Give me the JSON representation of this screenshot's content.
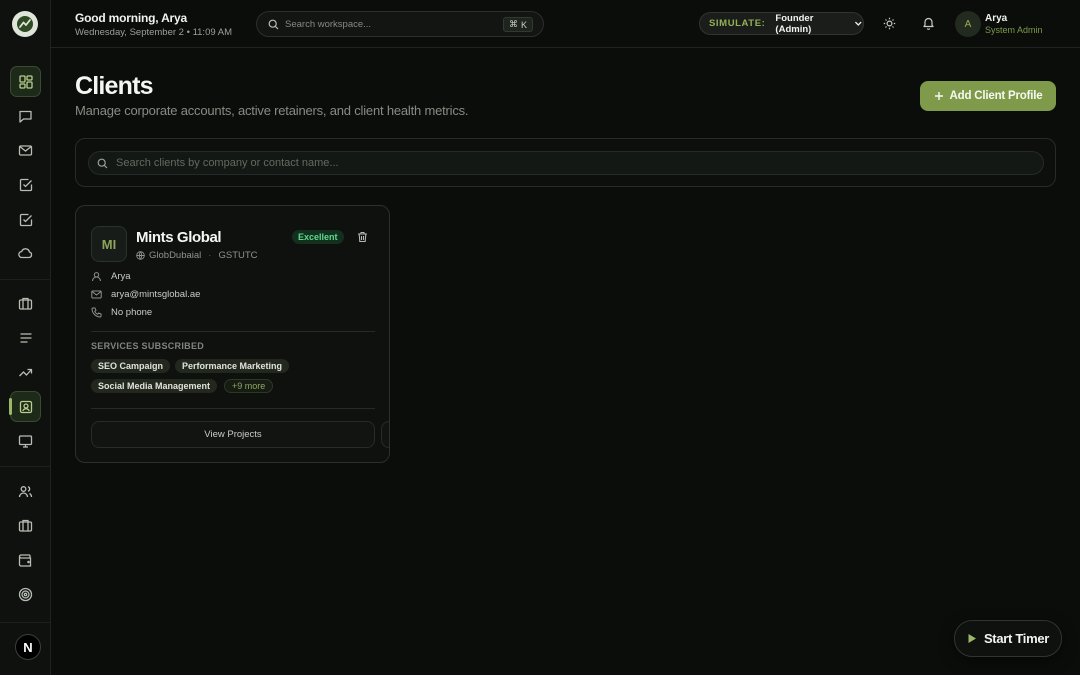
{
  "header": {
    "greeting": "Good morning, Arya",
    "datetime": "Wednesday, September 2 • 11:09 AM",
    "search_placeholder": "Search workspace...",
    "search_shortcut_symbol": "⌘",
    "search_shortcut_key": "K",
    "simulate_label": "SIMULATE:",
    "simulate_value": "Founder (Admin)",
    "user": {
      "initial": "A",
      "name": "Arya",
      "role": "System Admin"
    }
  },
  "sidebar": {
    "items": [
      {
        "icon": "dashboard-icon"
      },
      {
        "icon": "chat-icon"
      },
      {
        "icon": "mail-icon"
      },
      {
        "icon": "task-check-icon"
      },
      {
        "icon": "approval-check-icon"
      },
      {
        "icon": "cloud-icon"
      },
      {
        "icon": "briefcase-icon"
      },
      {
        "icon": "list-icon"
      },
      {
        "icon": "trending-up-icon"
      },
      {
        "icon": "clients-contact-icon",
        "active": true
      },
      {
        "icon": "monitor-icon"
      },
      {
        "icon": "users-icon"
      },
      {
        "icon": "portfolio-icon"
      },
      {
        "icon": "wallet-icon"
      },
      {
        "icon": "target-icon"
      }
    ],
    "footer_badge": "N"
  },
  "page": {
    "title": "Clients",
    "subtitle": "Manage corporate accounts, active retainers, and client health metrics.",
    "add_button": "Add Client Profile",
    "search_placeholder": "Search clients by company or contact name..."
  },
  "clients": [
    {
      "initials": "MI",
      "company": "Mints Global",
      "location": "GlobDubaial",
      "timezone": "GSTUTC",
      "health": "Excellent",
      "contact_name": "Arya",
      "email": "arya@mintsglobal.ae",
      "phone": "No phone",
      "services_title": "SERVICES SUBSCRIBED",
      "services": [
        "SEO Campaign",
        "Performance Marketing",
        "Social Media Management"
      ],
      "more_services": "+9 more",
      "view_button": "View Projects"
    }
  ],
  "timer": {
    "label": "Start Timer"
  },
  "colors": {
    "accent": "#7f9a4a",
    "background": "#0b0d0b",
    "health_good": "#5fd88e"
  }
}
